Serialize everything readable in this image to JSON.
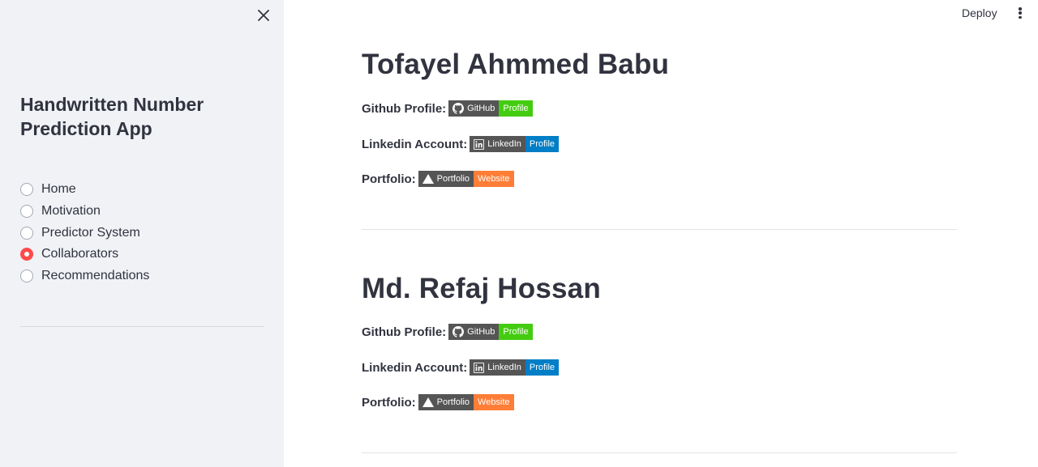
{
  "header": {
    "deploy_label": "Deploy",
    "menu_icon": "more-vertical-icon"
  },
  "sidebar": {
    "close_icon": "close-icon",
    "title": "Handwritten Number Prediction App",
    "nav": [
      {
        "label": "Home",
        "checked": false
      },
      {
        "label": "Motivation",
        "checked": false
      },
      {
        "label": "Predictor System",
        "checked": false
      },
      {
        "label": "Collaborators",
        "checked": true
      },
      {
        "label": "Recommendations",
        "checked": false
      }
    ],
    "accent_color": "#ff4b4b"
  },
  "collaborators": [
    {
      "name": "Tofayel Ahmmed Babu",
      "github": {
        "label": "Github Profile:",
        "badge_left": "GitHub",
        "badge_right": "Profile"
      },
      "linkedin": {
        "label": "Linkedin Account:",
        "badge_left": "LinkedIn",
        "badge_right": "Profile"
      },
      "portfolio": {
        "label": "Portfolio:",
        "badge_left": "Portfolio",
        "badge_right": "Website"
      }
    },
    {
      "name": "Md. Refaj Hossan",
      "github": {
        "label": "Github Profile:",
        "badge_left": "GitHub",
        "badge_right": "Profile"
      },
      "linkedin": {
        "label": "Linkedin Account:",
        "badge_left": "LinkedIn",
        "badge_right": "Profile"
      },
      "portfolio": {
        "label": "Portfolio:",
        "badge_left": "Portfolio",
        "badge_right": "Website"
      }
    }
  ],
  "badge_colors": {
    "dark": "#555555",
    "github": "#44cc11",
    "linkedin": "#007ec6",
    "portfolio": "#fe7d37"
  }
}
